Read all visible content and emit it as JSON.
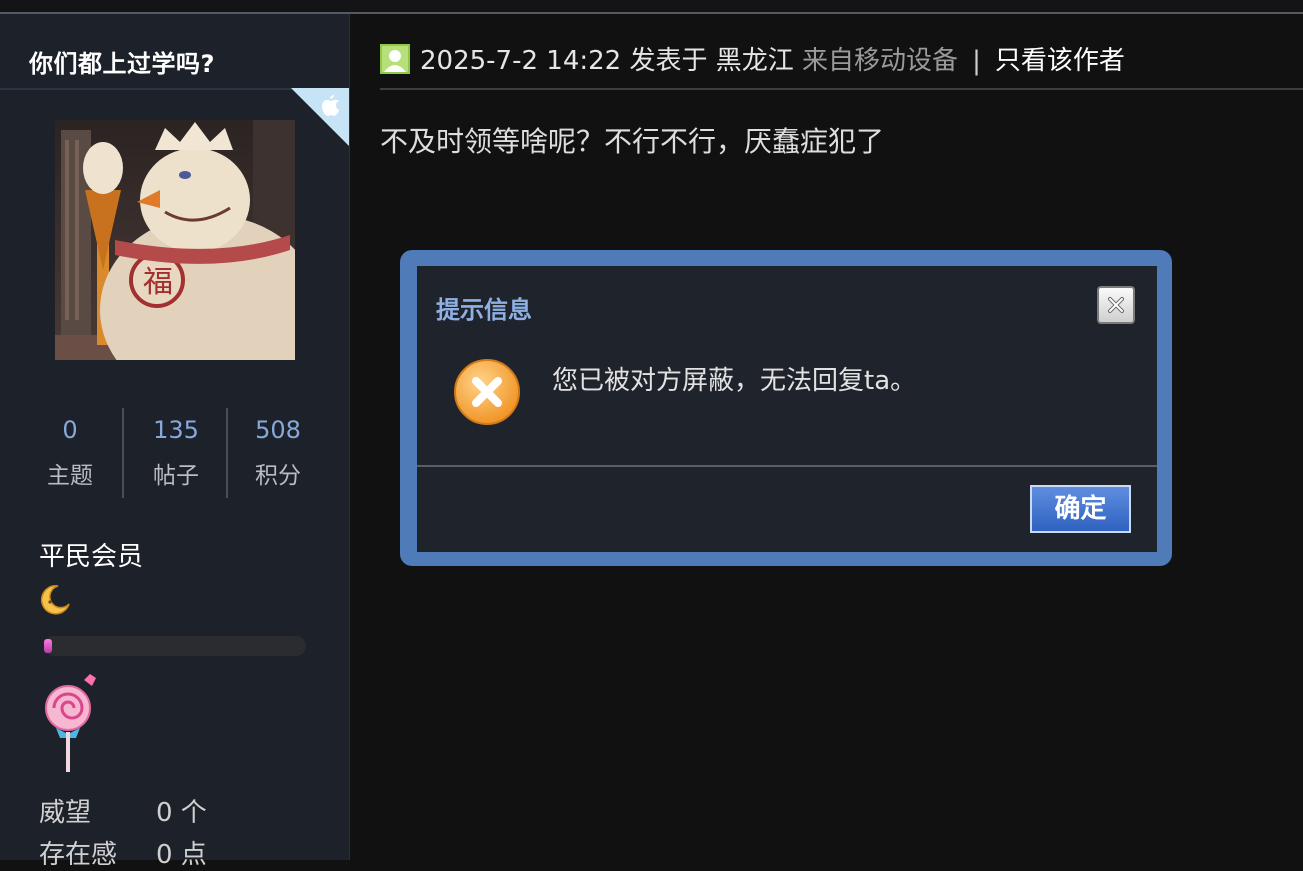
{
  "sidebar": {
    "username": "你们都上过学吗?",
    "stats": [
      {
        "value": "0",
        "label": "主题"
      },
      {
        "value": "135",
        "label": "帖子"
      },
      {
        "value": "508",
        "label": "积分"
      }
    ],
    "rank": "平民会员",
    "level_progress": 0.03,
    "props": [
      {
        "key": "威望",
        "value": "0 个"
      },
      {
        "key": "存在感",
        "value": "0 点"
      }
    ]
  },
  "post": {
    "datetime": "2025-7-2 14:22",
    "posted_in_label": "发表于",
    "location": "黑龙江",
    "source": "来自移动设备",
    "separator": "|",
    "only_author": "只看该作者",
    "body": "不及时领等啥呢？不行不行，厌蠢症犯了"
  },
  "dialog": {
    "title": "提示信息",
    "message": "您已被对方屏蔽，无法回复ta。",
    "ok_label": "确定"
  },
  "colors": {
    "dialog_border": "#4f7bb9",
    "accent_link": "#86a9db",
    "error_icon": "#f4a23a"
  }
}
